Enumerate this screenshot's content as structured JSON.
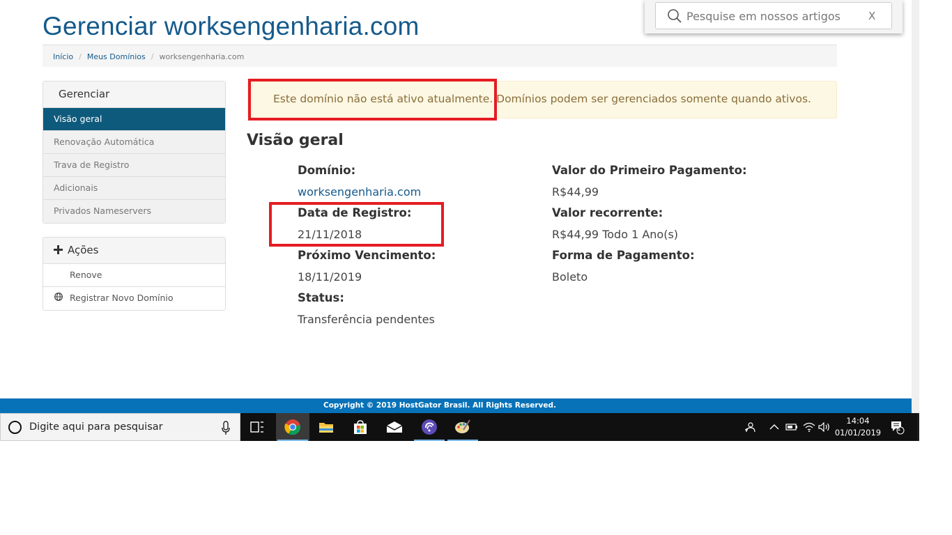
{
  "page": {
    "title": "Gerenciar worksengenharia.com"
  },
  "search": {
    "placeholder": "Pesquise em nossos artigos",
    "close_label": "X"
  },
  "breadcrumb": {
    "items": [
      "Início",
      "Meus Domínios"
    ],
    "current": "worksengenharia.com",
    "separator": "/"
  },
  "sidebar": {
    "manage": {
      "title": "Gerenciar",
      "items": [
        {
          "label": "Visão geral",
          "active": true
        },
        {
          "label": "Renovação Automática",
          "active": false
        },
        {
          "label": "Trava de Registro",
          "active": false
        },
        {
          "label": "Adicionais",
          "active": false
        },
        {
          "label": "Privados Nameservers",
          "active": false
        }
      ]
    },
    "actions": {
      "icon": "plus-icon",
      "title": "Ações",
      "items": [
        {
          "label": "Renove",
          "icon": ""
        },
        {
          "label": "Registrar Novo Domínio",
          "icon": "globe-icon"
        }
      ]
    }
  },
  "alert": {
    "message": "Este domínio não está ativo atualmente. Domínios podem ser gerenciados somente quando ativos."
  },
  "overview": {
    "title": "Visão geral",
    "left": [
      {
        "label": "Domínio",
        "value": "worksengenharia.com",
        "link": true
      },
      {
        "label": "Data de Registro",
        "value": "21/11/2018",
        "link": false
      },
      {
        "label": "Próximo Vencimento",
        "value": "18/11/2019",
        "link": false
      },
      {
        "label": "Status",
        "value": "Transferência pendentes",
        "link": false
      }
    ],
    "right": [
      {
        "label": "Valor do Primeiro Pagamento",
        "value": "R$44,99"
      },
      {
        "label": "Valor recorrente",
        "value": "R$44,99 Todo 1 Ano(s)"
      },
      {
        "label": "Forma de Pagamento",
        "value": "Boleto"
      }
    ]
  },
  "footer": {
    "text": "Copyright © 2019 HostGator Brasil. All Rights Reserved."
  },
  "taskbar": {
    "search_placeholder": "Digite aqui para pesquisar",
    "apps": [
      "task-view-icon",
      "chrome-icon",
      "file-explorer-icon",
      "store-icon",
      "mail-icon",
      "bittorrent-icon",
      "paint-icon"
    ],
    "tray": [
      "people-icon",
      "chevron-up-icon",
      "battery-icon",
      "wifi-icon",
      "volume-icon"
    ],
    "time": "14:04",
    "date": "01/01/2019",
    "notification_count": "1"
  },
  "colors": {
    "brand": "#155a8c",
    "active_menu": "#0e5a7c",
    "footer": "#0772b8",
    "alert_bg": "#fcf8e3",
    "alert_text": "#8a6d3b",
    "highlight": "#e51c23"
  }
}
